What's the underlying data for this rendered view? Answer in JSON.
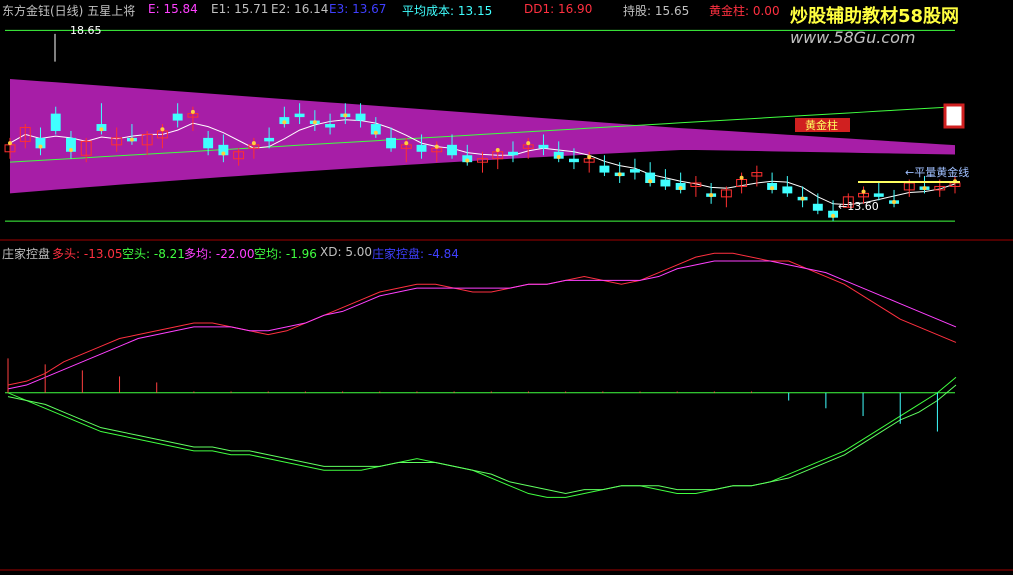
{
  "app": {
    "stock_name": "东方金钰(日线)",
    "indicator_name": "五星上将"
  },
  "top_panel": {
    "legend": [
      {
        "key": "E",
        "label": "E: 15.84",
        "color": "#ff40ff"
      },
      {
        "key": "E1",
        "label": "E1: 15.71",
        "color": "#c0c0c0"
      },
      {
        "key": "E2",
        "label": "E2: 16.14",
        "color": "#c0c0c0"
      },
      {
        "key": "E3",
        "label": "E3: 13.67",
        "color": "#3f3fff"
      },
      {
        "key": "avg_cost",
        "label": "平均成本: 13.15",
        "color": "#40ffff"
      },
      {
        "key": "DD1",
        "label": "DD1: 16.90",
        "color": "#ff3040"
      },
      {
        "key": "hold",
        "label": "持股: 15.65",
        "color": "#c0c0c0"
      },
      {
        "key": "golden_pillar",
        "label": "黄金柱: 0.00",
        "color": "#ff3040"
      }
    ],
    "annotations": {
      "high_label": "18.65",
      "low_label": "←13.60",
      "golden_line_label": "←平量黄金线",
      "golden_pillar_label": "黄金柱"
    },
    "colors": {
      "up": "#ff3030",
      "down": "#40ffff",
      "band": "#b020b0",
      "ma_white": "#ffffff",
      "ma_green": "#40ff40",
      "dots": "#ffd040"
    }
  },
  "bottom_panel": {
    "legend": [
      {
        "key": "bull",
        "label": "多头: -13.05",
        "color": "#ff3040"
      },
      {
        "key": "bear",
        "label": "空头: -8.21",
        "color": "#40ff40"
      },
      {
        "key": "bull_avg",
        "label": "多均: -22.00",
        "color": "#ff40ff"
      },
      {
        "key": "bear_avg",
        "label": "空均: -1.96",
        "color": "#40ff40"
      },
      {
        "key": "XD",
        "label": "XD: 5.00",
        "color": "#c0c0c0"
      },
      {
        "key": "control",
        "label": "庄家控盘: -4.84",
        "color": "#3f3fff"
      }
    ],
    "title": "庄家控盘"
  },
  "watermark": {
    "line1": "炒股辅助教材58股网",
    "line2": "www.58Gu.com"
  },
  "chart_data": {
    "type": "line",
    "candles": [
      [
        15.2,
        15.6,
        15.0,
        15.4
      ],
      [
        15.5,
        16.0,
        15.3,
        15.9
      ],
      [
        15.6,
        15.9,
        15.1,
        15.3
      ],
      [
        16.3,
        16.5,
        15.7,
        15.8
      ],
      [
        15.6,
        15.8,
        15.0,
        15.2
      ],
      [
        15.1,
        15.6,
        14.9,
        15.5
      ],
      [
        16.0,
        16.6,
        15.7,
        15.8
      ],
      [
        15.4,
        15.9,
        15.2,
        15.6
      ],
      [
        15.6,
        16.0,
        15.4,
        15.5
      ],
      [
        15.4,
        15.8,
        15.1,
        15.7
      ],
      [
        15.6,
        16.0,
        15.3,
        15.8
      ],
      [
        16.3,
        16.6,
        15.9,
        16.1
      ],
      [
        16.2,
        16.5,
        15.8,
        16.3
      ],
      [
        15.6,
        15.8,
        15.1,
        15.3
      ],
      [
        15.4,
        15.7,
        14.9,
        15.1
      ],
      [
        15.0,
        15.3,
        14.8,
        15.2
      ],
      [
        15.3,
        15.6,
        15.0,
        15.4
      ],
      [
        15.6,
        15.9,
        15.3,
        15.5
      ],
      [
        16.2,
        16.5,
        15.9,
        16.0
      ],
      [
        16.3,
        16.6,
        16.0,
        16.2
      ],
      [
        16.1,
        16.4,
        15.8,
        16.0
      ],
      [
        16.0,
        16.3,
        15.7,
        15.9
      ],
      [
        16.3,
        16.6,
        16.0,
        16.2
      ],
      [
        16.3,
        16.6,
        15.9,
        16.1
      ],
      [
        16.0,
        16.2,
        15.6,
        15.7
      ],
      [
        15.6,
        15.9,
        15.2,
        15.3
      ],
      [
        15.3,
        15.6,
        14.9,
        15.4
      ],
      [
        15.4,
        15.7,
        15.0,
        15.2
      ],
      [
        15.2,
        15.5,
        14.9,
        15.3
      ],
      [
        15.4,
        15.7,
        15.0,
        15.1
      ],
      [
        15.1,
        15.4,
        14.8,
        14.9
      ],
      [
        14.9,
        15.2,
        14.6,
        15.0
      ],
      [
        15.0,
        15.3,
        14.7,
        15.2
      ],
      [
        15.2,
        15.5,
        14.9,
        15.1
      ],
      [
        15.3,
        15.6,
        15.0,
        15.4
      ],
      [
        15.4,
        15.7,
        15.1,
        15.3
      ],
      [
        15.2,
        15.5,
        14.9,
        15.0
      ],
      [
        15.0,
        15.3,
        14.7,
        14.9
      ],
      [
        14.9,
        15.2,
        14.6,
        15.0
      ],
      [
        14.8,
        15.1,
        14.5,
        14.6
      ],
      [
        14.6,
        14.9,
        14.3,
        14.5
      ],
      [
        14.7,
        15.0,
        14.4,
        14.6
      ],
      [
        14.6,
        14.9,
        14.2,
        14.3
      ],
      [
        14.4,
        14.7,
        14.1,
        14.2
      ],
      [
        14.3,
        14.6,
        14.0,
        14.1
      ],
      [
        14.2,
        14.5,
        13.9,
        14.3
      ],
      [
        14.0,
        14.3,
        13.7,
        13.9
      ],
      [
        13.9,
        14.2,
        13.6,
        14.1
      ],
      [
        14.2,
        14.6,
        14.0,
        14.4
      ],
      [
        14.5,
        14.8,
        14.2,
        14.6
      ],
      [
        14.3,
        14.6,
        14.0,
        14.1
      ],
      [
        14.2,
        14.5,
        13.9,
        14.0
      ],
      [
        13.9,
        14.2,
        13.6,
        13.8
      ],
      [
        13.7,
        14.0,
        13.4,
        13.5
      ],
      [
        13.5,
        13.8,
        13.2,
        13.3
      ],
      [
        13.6,
        14.0,
        13.6,
        13.9
      ],
      [
        13.9,
        14.2,
        13.7,
        14.0
      ],
      [
        14.0,
        14.3,
        13.8,
        13.9
      ],
      [
        13.8,
        14.1,
        13.6,
        13.7
      ],
      [
        14.1,
        14.4,
        13.9,
        14.3
      ],
      [
        14.2,
        14.5,
        14.0,
        14.1
      ],
      [
        14.1,
        14.4,
        13.9,
        14.2
      ],
      [
        14.2,
        14.5,
        14.0,
        14.3
      ]
    ],
    "bottom_series": [
      {
        "name": "多头",
        "values": [
          -2,
          -3,
          -5,
          -8,
          -10,
          -12,
          -14,
          -15,
          -16,
          -17,
          -18,
          -18,
          -17,
          -16,
          -15,
          -16,
          -18,
          -20,
          -22,
          -24,
          -26,
          -27,
          -28,
          -28,
          -27,
          -26,
          -26,
          -27,
          -28,
          -28,
          -29,
          -30,
          -29,
          -28,
          -29,
          -31,
          -33,
          -35,
          -36,
          -36,
          -35,
          -34,
          -34,
          -32,
          -30,
          -28,
          -25,
          -22,
          -19,
          -17,
          -15,
          -13
        ]
      },
      {
        "name": "空头",
        "values": [
          0,
          2,
          4,
          6,
          8,
          10,
          11,
          12,
          13,
          14,
          15,
          15,
          16,
          16,
          17,
          18,
          19,
          20,
          20,
          20,
          19,
          18,
          17,
          18,
          19,
          20,
          22,
          24,
          26,
          27,
          27,
          26,
          25,
          24,
          24,
          25,
          26,
          26,
          25,
          24,
          24,
          23,
          21,
          19,
          17,
          15,
          12,
          9,
          6,
          3,
          0,
          -4
        ]
      },
      {
        "name": "多均",
        "values": [
          -1,
          -2,
          -4,
          -6,
          -8,
          -10,
          -12,
          -14,
          -15,
          -16,
          -17,
          -17,
          -17,
          -16,
          -16,
          -17,
          -18,
          -20,
          -21,
          -23,
          -25,
          -26,
          -27,
          -27,
          -27,
          -27,
          -27,
          -27,
          -28,
          -28,
          -29,
          -29,
          -29,
          -29,
          -29,
          -30,
          -32,
          -33,
          -34,
          -34,
          -34,
          -34,
          -33,
          -32,
          -31,
          -29,
          -27,
          -25,
          -23,
          -21,
          -19,
          -17
        ]
      },
      {
        "name": "空均",
        "values": [
          1,
          2,
          3,
          5,
          7,
          9,
          10,
          11,
          12,
          13,
          14,
          14,
          15,
          15,
          16,
          17,
          18,
          19,
          19,
          19,
          19,
          18,
          18,
          18,
          19,
          20,
          21,
          23,
          24,
          25,
          26,
          25,
          25,
          24,
          24,
          24,
          25,
          25,
          25,
          24,
          24,
          23,
          22,
          20,
          18,
          16,
          13,
          10,
          7,
          5,
          2,
          -2
        ]
      }
    ],
    "xlabel": "",
    "ylabel": ""
  }
}
